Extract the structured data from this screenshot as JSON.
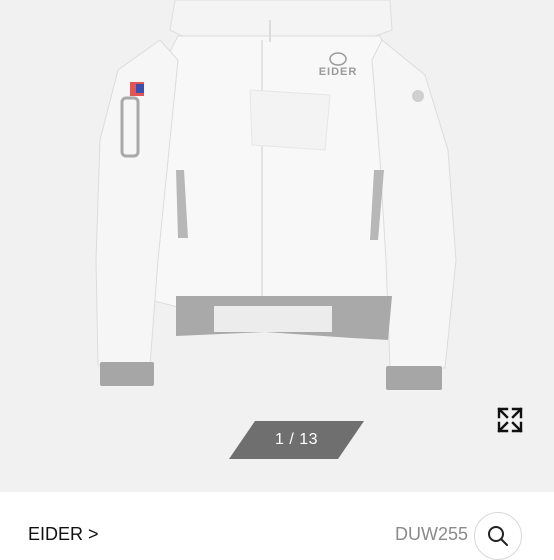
{
  "gallery": {
    "image_alt": "EIDER white down jacket",
    "counter": "1 / 13",
    "expand_icon": "expand-arrows-icon",
    "jacket_logo": "EIDER"
  },
  "product": {
    "brand": "EIDER >",
    "model_code": "DUW255",
    "search_icon": "search-icon"
  },
  "colors": {
    "background": "#f1f1f1",
    "jacket": "#f7f7f7",
    "trim": "#a9a9a9",
    "badge": "#6f6f6f"
  }
}
